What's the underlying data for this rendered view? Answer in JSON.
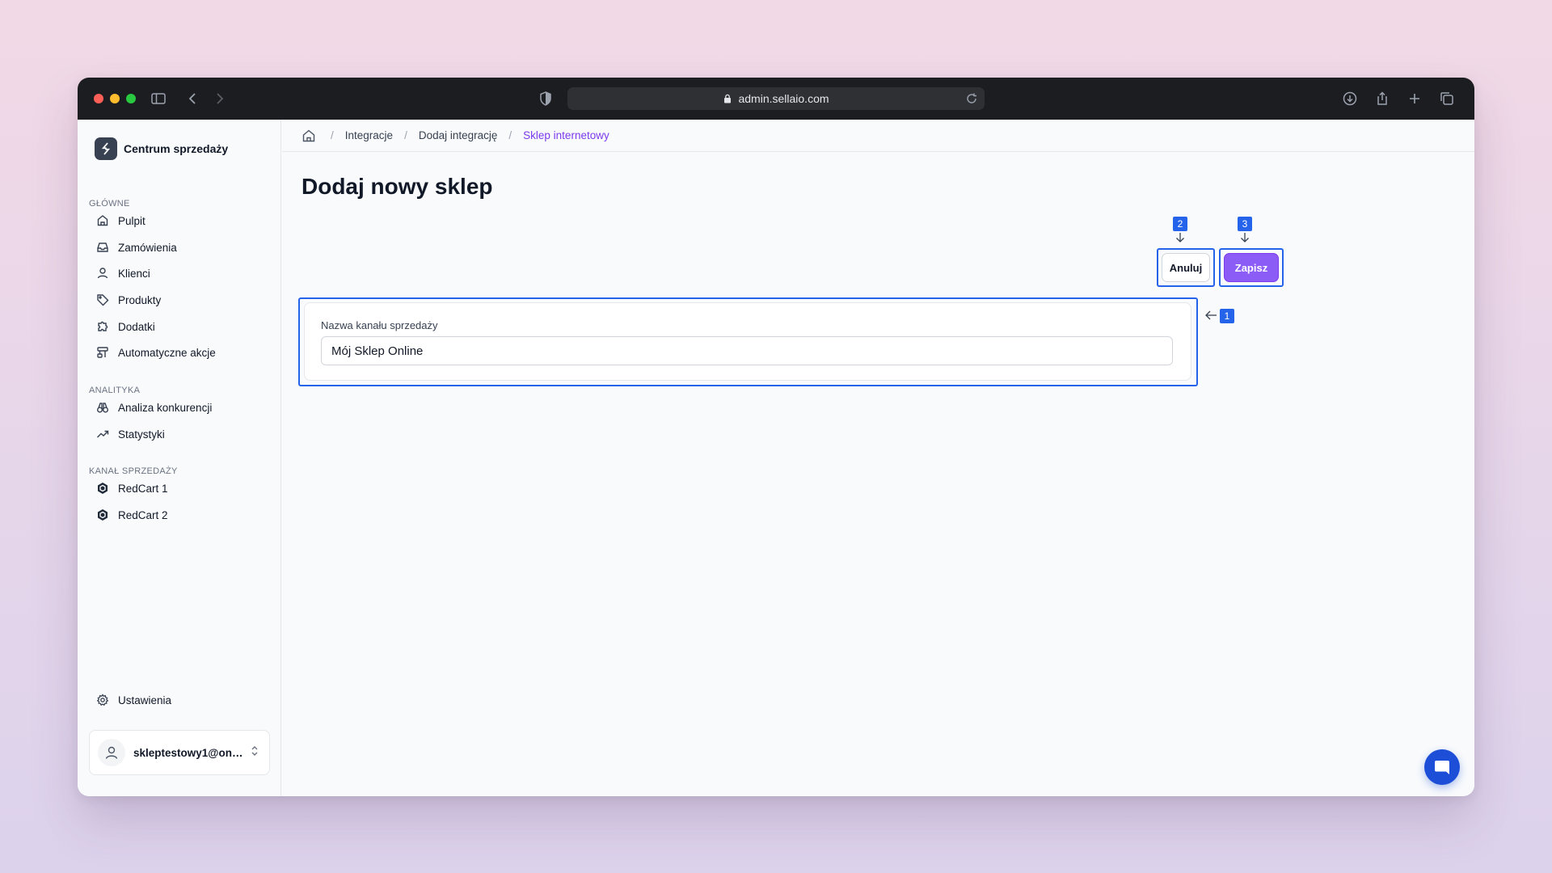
{
  "browser": {
    "url": "admin.sellaio.com"
  },
  "sidebar": {
    "brand": "Centrum sprzedaży",
    "sections": [
      {
        "label": "GŁÓWNE",
        "items": [
          {
            "label": "Pulpit",
            "icon": "home-icon"
          },
          {
            "label": "Zamówienia",
            "icon": "inbox-icon"
          },
          {
            "label": "Klienci",
            "icon": "user-icon"
          },
          {
            "label": "Produkty",
            "icon": "tag-icon"
          },
          {
            "label": "Dodatki",
            "icon": "puzzle-icon"
          },
          {
            "label": "Automatyczne akcje",
            "icon": "workflow-icon"
          }
        ]
      },
      {
        "label": "ANALITYKA",
        "items": [
          {
            "label": "Analiza konkurencji",
            "icon": "binoculars-icon"
          },
          {
            "label": "Statystyki",
            "icon": "trend-up-icon"
          }
        ]
      },
      {
        "label": "KANAŁ SPRZEDAŻY",
        "items": [
          {
            "label": "RedCart 1",
            "icon": "hexagon-logo-icon"
          },
          {
            "label": "RedCart 2",
            "icon": "hexagon-logo-icon"
          }
        ]
      }
    ],
    "settings": {
      "label": "Ustawienia",
      "icon": "gear-icon"
    },
    "account": {
      "email": "skleptestowy1@onet.pl"
    }
  },
  "breadcrumb": {
    "items": [
      "Integracje",
      "Dodaj integrację"
    ],
    "current": "Sklep internetowy"
  },
  "page": {
    "title": "Dodaj nowy sklep",
    "cancel_label": "Anuluj",
    "save_label": "Zapisz"
  },
  "form": {
    "channel_name_label": "Nazwa kanału sprzedaży",
    "channel_name_value": "Mój Sklep Online"
  },
  "annotations": [
    "1",
    "2",
    "3"
  ],
  "colors": {
    "accent": "#8b5cf6",
    "annotation": "#2563eb",
    "breadcrumb_current": "#7c3aed"
  }
}
